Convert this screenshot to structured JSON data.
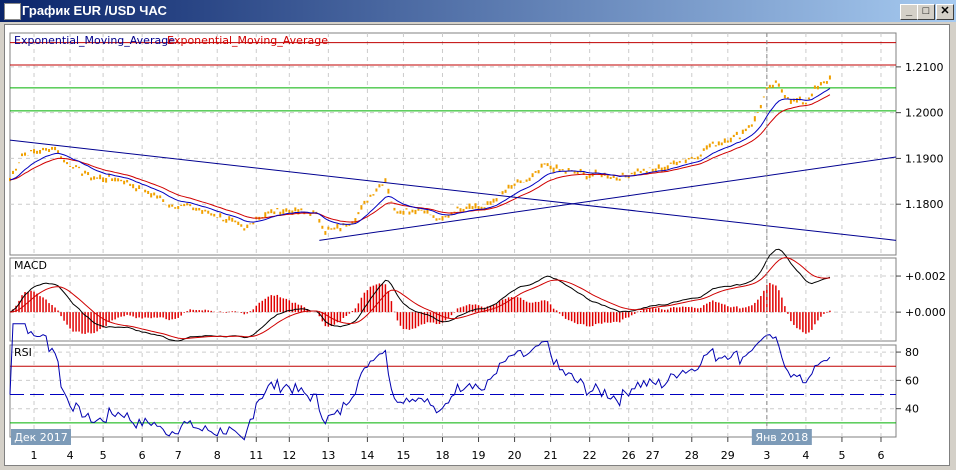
{
  "window": {
    "title": "График EUR /USD  ЧАС",
    "minimize": "_",
    "maximize": "□",
    "close": "✕"
  },
  "legend": {
    "ema1": "Exponential_Moving_Average",
    "ema2": "Exponential_Moving_Average"
  },
  "colors": {
    "price": "#f0a000",
    "ema_fast": "#0000c0",
    "ema_slow": "#d00000",
    "trend": "#000090",
    "red_level": "#c00000",
    "green_level": "#00b000",
    "rsi": "#0000b0",
    "rsi_ob": "#c000c0"
  },
  "chart_data": [
    {
      "type": "line",
      "title": "EUR/USD H1",
      "ylim": [
        1.1689,
        1.2174
      ],
      "xlim": [
        0,
        295
      ],
      "yticks": [
        "1.2100",
        "1.2000",
        "1.1900",
        "1.1800"
      ],
      "ytick_values": [
        1.21,
        1.2,
        1.19,
        1.18
      ],
      "price_keypoints": [
        [
          0,
          1.1853
        ],
        [
          4,
          1.1907
        ],
        [
          10,
          1.1918
        ],
        [
          15,
          1.1923
        ],
        [
          18,
          1.1896
        ],
        [
          23,
          1.1875
        ],
        [
          28,
          1.1857
        ],
        [
          33,
          1.1857
        ],
        [
          38,
          1.1853
        ],
        [
          43,
          1.1831
        ],
        [
          48,
          1.182
        ],
        [
          53,
          1.1798
        ],
        [
          58,
          1.1798
        ],
        [
          63,
          1.1787
        ],
        [
          68,
          1.1776
        ],
        [
          73,
          1.1765
        ],
        [
          78,
          1.1743
        ],
        [
          82,
          1.177
        ],
        [
          87,
          1.1783
        ],
        [
          92,
          1.1787
        ],
        [
          97,
          1.1783
        ],
        [
          102,
          1.1776
        ],
        [
          105,
          1.1743
        ],
        [
          110,
          1.1748
        ],
        [
          115,
          1.177
        ],
        [
          120,
          1.182
        ],
        [
          125,
          1.1853
        ],
        [
          128,
          1.1787
        ],
        [
          133,
          1.1787
        ],
        [
          138,
          1.1787
        ],
        [
          143,
          1.1761
        ],
        [
          148,
          1.1787
        ],
        [
          153,
          1.1798
        ],
        [
          158,
          1.1791
        ],
        [
          163,
          1.182
        ],
        [
          168,
          1.1842
        ],
        [
          173,
          1.1853
        ],
        [
          178,
          1.1886
        ],
        [
          183,
          1.1875
        ],
        [
          188,
          1.187
        ],
        [
          193,
          1.1864
        ],
        [
          198,
          1.1864
        ],
        [
          203,
          1.1857
        ],
        [
          208,
          1.187
        ],
        [
          213,
          1.1875
        ],
        [
          218,
          1.1879
        ],
        [
          223,
          1.1896
        ],
        [
          228,
          1.1901
        ],
        [
          233,
          1.1929
        ],
        [
          238,
          1.194
        ],
        [
          243,
          1.1951
        ],
        [
          248,
          1.1984
        ],
        [
          252,
          1.205
        ],
        [
          255,
          1.2061
        ],
        [
          260,
          1.2028
        ],
        [
          265,
          1.2023
        ],
        [
          268,
          1.205
        ],
        [
          273,
          1.2076
        ]
      ],
      "levels_red": [
        1.2153,
        1.2104
      ],
      "levels_green": [
        1.2054,
        1.2004
      ],
      "trendlines": [
        [
          [
            0,
            1.194
          ],
          [
            295,
            1.1721
          ]
        ],
        [
          [
            103,
            1.1721
          ],
          [
            295,
            1.1903
          ]
        ]
      ],
      "vline_x": 252
    },
    {
      "type": "line",
      "title": "MACD",
      "ylim": [
        -0.0016,
        0.003
      ],
      "yticks": [
        "+0.002",
        "+0.000"
      ],
      "ytick_values": [
        0.002,
        0
      ]
    },
    {
      "type": "line",
      "title": "RSI",
      "ylim": [
        20,
        85
      ],
      "yticks": [
        "80",
        "60",
        "40"
      ],
      "ytick_values": [
        80,
        60,
        40
      ],
      "levels": {
        "upper": 70,
        "mid": 50,
        "lower": 30
      }
    }
  ],
  "xaxis": {
    "ticks": [
      {
        "label": "1",
        "x": 8
      },
      {
        "label": "4",
        "x": 20
      },
      {
        "label": "5",
        "x": 31
      },
      {
        "label": "6",
        "x": 44
      },
      {
        "label": "7",
        "x": 56
      },
      {
        "label": "8",
        "x": 69
      },
      {
        "label": "11",
        "x": 82
      },
      {
        "label": "12",
        "x": 93
      },
      {
        "label": "13",
        "x": 106
      },
      {
        "label": "14",
        "x": 119
      },
      {
        "label": "15",
        "x": 131
      },
      {
        "label": "18",
        "x": 144
      },
      {
        "label": "19",
        "x": 156
      },
      {
        "label": "20",
        "x": 168
      },
      {
        "label": "21",
        "x": 180
      },
      {
        "label": "22",
        "x": 193
      },
      {
        "label": "26",
        "x": 206
      },
      {
        "label": "27",
        "x": 214
      },
      {
        "label": "28",
        "x": 227
      },
      {
        "label": "29",
        "x": 239
      },
      {
        "label": "3",
        "x": 252
      },
      {
        "label": "4",
        "x": 265
      },
      {
        "label": "5",
        "x": 277
      },
      {
        "label": "6",
        "x": 290
      }
    ],
    "month_labels": [
      {
        "label": "Дек 2017",
        "x": 0
      },
      {
        "label": "Янв 2018",
        "x": 247
      }
    ]
  }
}
